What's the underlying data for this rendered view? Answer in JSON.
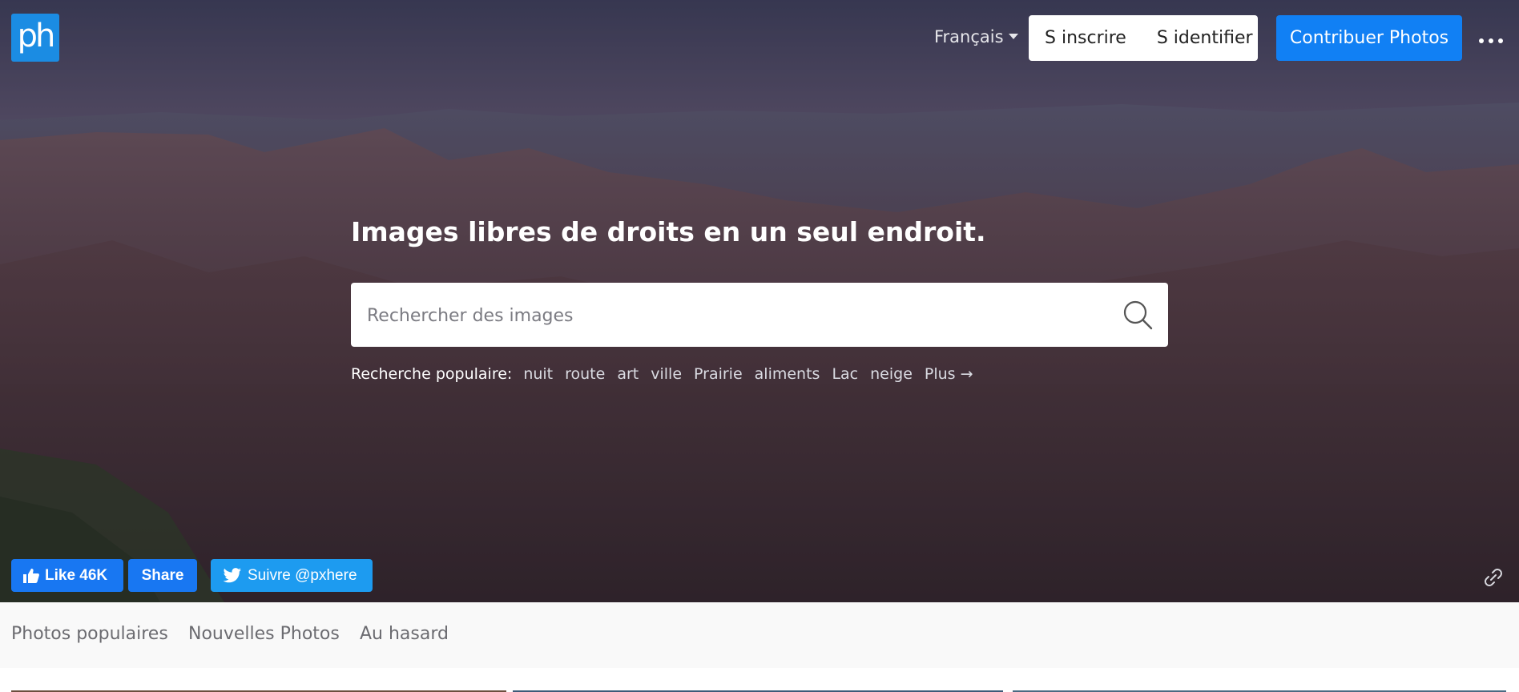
{
  "header": {
    "logo_text": "ph",
    "language": "Français",
    "signup_label": "S inscrire",
    "signin_label": "S identifier",
    "contribute_label": "Contribuer Photos",
    "more_icon": "more-dots-icon"
  },
  "hero": {
    "headline": "Images libres de droits en un seul endroit.",
    "search": {
      "placeholder": "Rechercher des images",
      "value": "",
      "icon": "search-icon"
    },
    "popular": {
      "label": "Recherche populaire:",
      "tags": [
        "nuit",
        "route",
        "art",
        "ville",
        "Prairie",
        "aliments",
        "Lac",
        "neige",
        "Plus →"
      ]
    }
  },
  "social": {
    "fb_like_label": "Like 46K",
    "fb_share_label": "Share",
    "twitter_label": "Suivre @pxhere"
  },
  "nav": {
    "tabs": [
      "Photos populaires",
      "Nouvelles Photos",
      "Au hasard"
    ]
  },
  "colors": {
    "primary_blue": "#1180f4",
    "logo_blue": "#1b8ce3",
    "facebook_blue": "#1877f2",
    "twitter_blue": "#1d9bf0"
  }
}
